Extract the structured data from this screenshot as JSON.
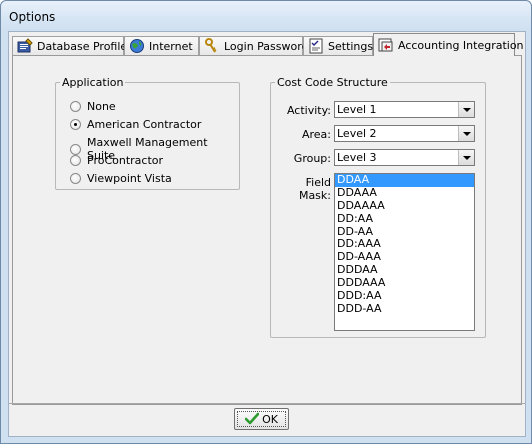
{
  "window": {
    "title": "Options"
  },
  "tabs": [
    {
      "label": "Database Profile",
      "icon": "database-profile-icon"
    },
    {
      "label": "Internet",
      "icon": "globe-icon"
    },
    {
      "label": "Login Password",
      "icon": "keys-icon"
    },
    {
      "label": "Settings",
      "icon": "settings-icon"
    },
    {
      "label": "Accounting Integration",
      "icon": "accounting-integration-icon",
      "active": true
    }
  ],
  "application": {
    "legend": "Application",
    "options": [
      "None",
      "American Contractor",
      "Maxwell Management Suite",
      "ProContractor",
      "Viewpoint Vista"
    ],
    "selected": "American Contractor"
  },
  "cost_code": {
    "legend": "Cost Code Structure",
    "activity_label": "Activity:",
    "activity_value": "Level 1",
    "area_label": "Area:",
    "area_value": "Level 2",
    "group_label": "Group:",
    "group_value": "Level 3",
    "field_mask_label": "Field Mask:",
    "field_mask_options": [
      "DDAA",
      "DDAAA",
      "DDAAAA",
      "DD:AA",
      "DD-AA",
      "DD:AAA",
      "DD-AAA",
      "DDDAA",
      "DDDAAA",
      "DDD:AA",
      "DDD-AA"
    ],
    "field_mask_selected": "DDAA"
  },
  "footer": {
    "ok_label": "OK"
  },
  "colors": {
    "selection": "#3399ff",
    "panel": "#f0f0f0",
    "frame": "#cfe0f1",
    "ok_check": "#2e9b2e"
  }
}
